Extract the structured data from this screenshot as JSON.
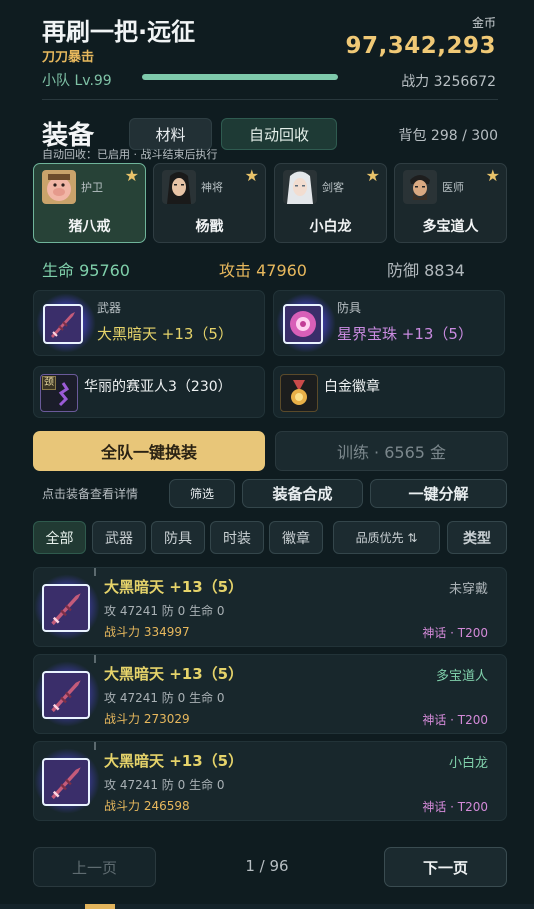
{
  "header": {
    "title": "再刷一把·远征",
    "subtitle": "刀刀暴击",
    "gold_label": "金币",
    "gold_value": "97,342,293",
    "team_level": "小队 Lv.99",
    "power": "战力 3256672"
  },
  "equip": {
    "title": "装备",
    "tab_material": "材料",
    "tab_recycle": "自动回收",
    "bag": "背包 298 / 300",
    "auto_note": "自动回收：已启用 · 战斗结束后执行"
  },
  "heroes": [
    {
      "role": "护卫",
      "name": "猪八戒",
      "selected": true
    },
    {
      "role": "神将",
      "name": "杨戬",
      "selected": false
    },
    {
      "role": "剑客",
      "name": "小白龙",
      "selected": false
    },
    {
      "role": "医师",
      "name": "多宝道人",
      "selected": false
    }
  ],
  "hero_star": "★",
  "stats": {
    "hp": "生命 95760",
    "atk": "攻击 47960",
    "def": "防御 8834"
  },
  "slots": {
    "weapon": {
      "kind": "武器",
      "name": "大黑暗天 +13（5）",
      "color": "#e5d36a"
    },
    "armor": {
      "kind": "防具",
      "name": "星界宝珠 +13（5）",
      "color": "#c98be0"
    },
    "necklace": {
      "badge": "颈",
      "name": "华丽的赛亚人3（230）"
    },
    "badge": {
      "name": "白金徽章"
    }
  },
  "actions": {
    "equip_all": "全队一键换装",
    "train": "训练 · 6565 金",
    "hint": "点击装备查看详情",
    "filter": "筛选",
    "synth": "装备合成",
    "split": "一键分解"
  },
  "filters": {
    "all": "全部",
    "weapon": "武器",
    "armor": "防具",
    "fashion": "时装",
    "badge": "徽章",
    "sort": "品质优先 ⇅",
    "type": "类型"
  },
  "items": [
    {
      "name": "大黑暗天 +13（5）",
      "stats": "攻 47241  防 0  生命 0",
      "power": "战斗力 334997",
      "owner": "未穿戴",
      "tier": "神话 · T200"
    },
    {
      "name": "大黑暗天 +13（5）",
      "stats": "攻 47241  防 0  生命 0",
      "power": "战斗力 273029",
      "owner": "多宝道人",
      "tier": "神话 · T200"
    },
    {
      "name": "大黑暗天 +13（5）",
      "stats": "攻 47241  防 0  生命 0",
      "power": "战斗力 246598",
      "owner": "小白龙",
      "tier": "神话 · T200"
    }
  ],
  "pager": {
    "prev": "上一页",
    "page": "1 / 96",
    "next": "下一页"
  }
}
